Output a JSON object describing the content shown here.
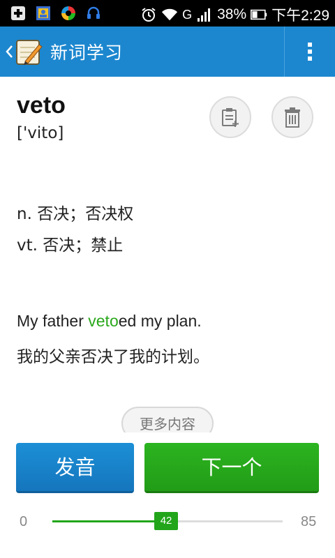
{
  "status_bar": {
    "battery": "38%",
    "time": "下午2:29",
    "network": "G",
    "icons": [
      "plus-square-icon",
      "contacts-icon",
      "colorful-app-icon",
      "headset-icon",
      "alarm-icon",
      "wifi-icon",
      "signal-icon",
      "battery-icon"
    ]
  },
  "action_bar": {
    "title": "新词学习",
    "back_icon": "chevron-left-icon",
    "menu_icon": "overflow-menu-icon"
  },
  "word": {
    "text": "veto",
    "phonetic": "['vito]"
  },
  "actions": {
    "add_note_icon": "note-add-icon",
    "delete_icon": "trash-icon"
  },
  "definitions": [
    "n. 否决；否决权",
    "vt. 否决；禁止"
  ],
  "example": {
    "before": "My father ",
    "highlight": "veto",
    "after": "ed my plan.",
    "translation": "我的父亲否决了我的计划。"
  },
  "more_button": "更多内容",
  "buttons": {
    "pronounce": "发音",
    "next": "下一个"
  },
  "progress": {
    "min": "0",
    "max": "85",
    "current": "42",
    "value": 42,
    "total": 85
  },
  "colors": {
    "accent_blue": "#1c87cf",
    "accent_green": "#22a51a",
    "status_bar": "#000000"
  }
}
